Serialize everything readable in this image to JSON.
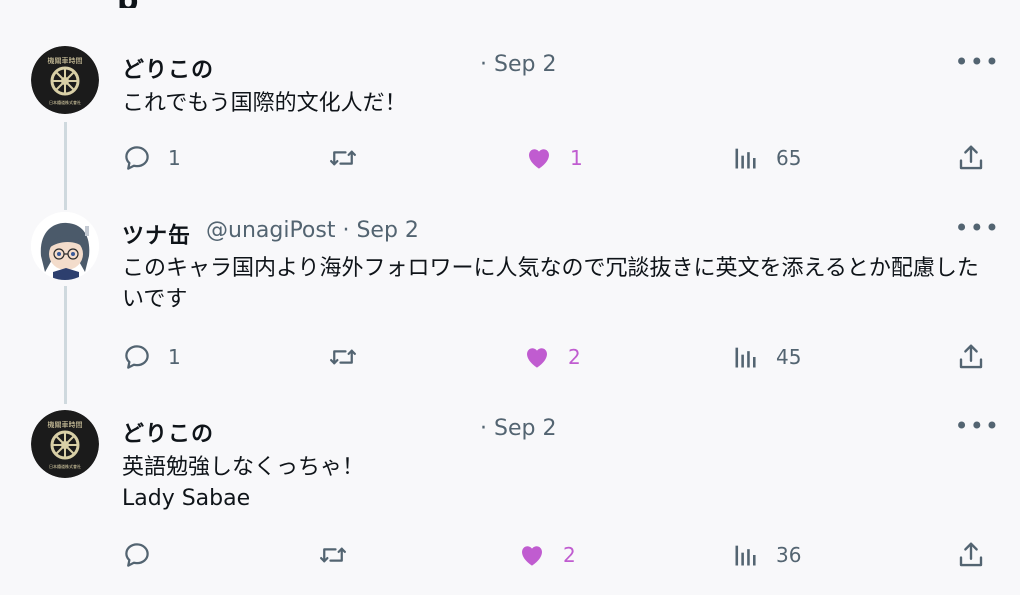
{
  "header": {
    "cut_label": "p"
  },
  "tweets": [
    {
      "name": "どりこの",
      "handle": "",
      "date": "· Sep 2",
      "text": "これでもう国際的文化人だ！",
      "more": "•••",
      "replies": "1",
      "retweets": "",
      "likes": "1",
      "liked": true,
      "views": "65",
      "avatar": {
        "top_text": "機關車時間",
        "bottom_text": "日本鐵道株式會社"
      }
    },
    {
      "name": "ツナ缶",
      "handle": "@unagiPost · Sep 2",
      "date": "",
      "text": "このキャラ国内より海外フォロワーに人気なので冗談抜きに英文を添えるとか配慮したいです",
      "more": "•••",
      "replies": "1",
      "retweets": "",
      "likes": "2",
      "liked": true,
      "views": "45"
    },
    {
      "name": "どりこの",
      "handle": "",
      "date": "· Sep 2",
      "text": "英語勉強しなくっちゃ！\nLady Sabae",
      "more": "•••",
      "replies": "",
      "retweets": "",
      "likes": "2",
      "liked": true,
      "views": "36",
      "avatar": {
        "top_text": "機關車時間",
        "bottom_text": "日本鐵道株式會社"
      }
    }
  ],
  "colors": {
    "like": "#c05cd0",
    "muted": "#536471",
    "thread_line": "#cfd9de"
  },
  "icons": [
    "reply-icon",
    "retweet-icon",
    "like-icon",
    "views-icon",
    "share-icon",
    "more-icon"
  ]
}
